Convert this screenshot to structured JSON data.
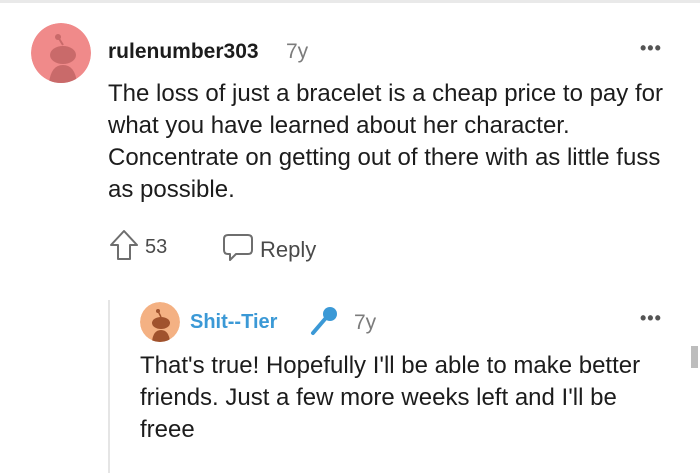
{
  "colors": {
    "avatar1_bg": "#f08a8a",
    "avatar2_bg": "#f4b183",
    "username2": "#3b99d6",
    "meta_gray": "#7c7c7c"
  },
  "comment1": {
    "author": "rulenumber303",
    "time": "7y",
    "more": "•••",
    "body": "The loss of just a bracelet is a cheap price to pay for what you have learned about her character. Concentrate on getting out of there with as little fuss as possible.",
    "upvote_icon": "upvote-arrow-icon",
    "score": "53",
    "reply_icon": "speech-bubble-icon",
    "reply_label": "Reply"
  },
  "comment2": {
    "author": "Shit--Tier",
    "flair_icon": "microphone-icon",
    "time": "7y",
    "more": "•••",
    "body": "That's true! Hopefully I'll be able to make better friends. Just a few more weeks left and I'll be freee"
  }
}
